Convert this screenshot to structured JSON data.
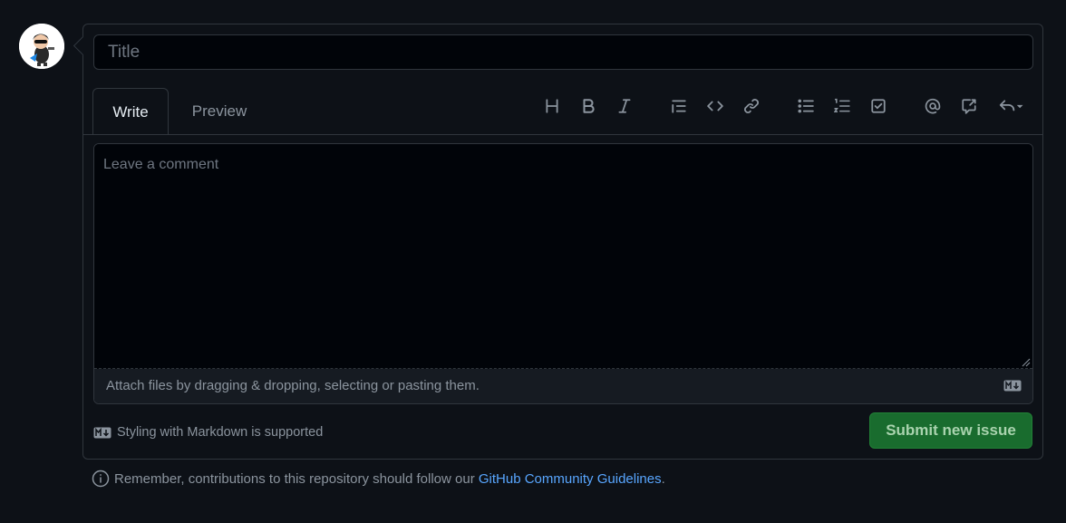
{
  "avatar": {
    "icon": "octocat-avatar-icon"
  },
  "form": {
    "title_placeholder": "Title",
    "tabs": [
      {
        "label": "Write",
        "active": true
      },
      {
        "label": "Preview",
        "active": false
      }
    ],
    "toolbar": [
      {
        "name": "heading-icon"
      },
      {
        "name": "bold-icon"
      },
      {
        "name": "italic-icon"
      },
      {
        "name": "quote-icon"
      },
      {
        "name": "code-icon"
      },
      {
        "name": "link-icon"
      },
      {
        "name": "bulleted-list-icon"
      },
      {
        "name": "numbered-list-icon"
      },
      {
        "name": "task-list-icon"
      },
      {
        "name": "mention-icon"
      },
      {
        "name": "cross-reference-icon"
      },
      {
        "name": "saved-replies-icon"
      }
    ],
    "comment_placeholder": "Leave a comment",
    "attach_text": "Attach files by dragging & dropping, selecting or pasting them.",
    "markdown_note": "Styling with Markdown is supported",
    "submit_label": "Submit new issue"
  },
  "footer": {
    "text_before": "Remember, contributions to this repository should follow our ",
    "link_text": "GitHub Community Guidelines",
    "text_after": "."
  },
  "colors": {
    "background": "#0d1117",
    "border": "#30363d",
    "submit_bg": "#196c2e",
    "link": "#58a6ff"
  }
}
